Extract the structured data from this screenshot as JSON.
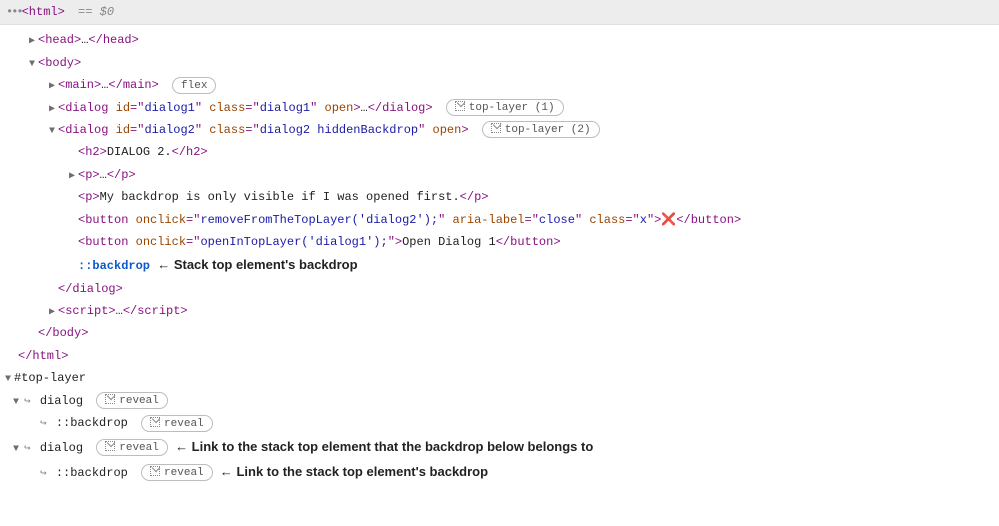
{
  "topbar": {
    "root_tag": "<html>",
    "selector_hint": "== $0"
  },
  "tags": {
    "head_open": "<head>",
    "head_close": "</head>",
    "body_open": "<body>",
    "body_close": "</body>",
    "html_close": "</html>",
    "main_open": "<main>",
    "main_close": "</main>",
    "dialog_open": "<dialog",
    "dialog_close_tag": "</dialog>",
    "h2_open": "<h2>",
    "h2_close": "</h2>",
    "p_open": "<p>",
    "p_close": "</p>",
    "button_open": "<button",
    "button_close": "</button>",
    "script_open": "<script>",
    "script_close_tag": "</script>",
    "ellipsis": "…",
    "gt": ">"
  },
  "attr": {
    "id": "id",
    "class": "class",
    "open": "open",
    "onclick": "onclick",
    "aria_label": "aria-label"
  },
  "dialog1": {
    "id_val": "dialog1",
    "class_val": "dialog1"
  },
  "dialog2": {
    "id_val": "dialog2",
    "class_val": "dialog2 hiddenBackdrop",
    "h2_text": "DIALOG 2.",
    "p_text": "My backdrop is only visible if I was opened first.",
    "btn1": {
      "onclick_val": "removeFromTheTopLayer('dialog2');",
      "aria_label_val": "close",
      "class_val": "x",
      "text": "❌"
    },
    "btn2": {
      "onclick_val": "openInTopLayer('dialog1');",
      "text": "Open Dialog 1"
    },
    "backdrop_label": "::backdrop",
    "backdrop_annot": "← Stack top element's backdrop"
  },
  "pills": {
    "flex": "flex",
    "top_layer_1": "top-layer (1)",
    "top_layer_2": "top-layer (2)",
    "reveal": "reveal"
  },
  "toplayer": {
    "header": "#top-layer",
    "dialog_label": "dialog",
    "backdrop_label": "::backdrop",
    "annot_dialog": "← Link to the stack top element that the backdrop below belongs to",
    "annot_backdrop": "← Link to the stack top element's backdrop"
  }
}
